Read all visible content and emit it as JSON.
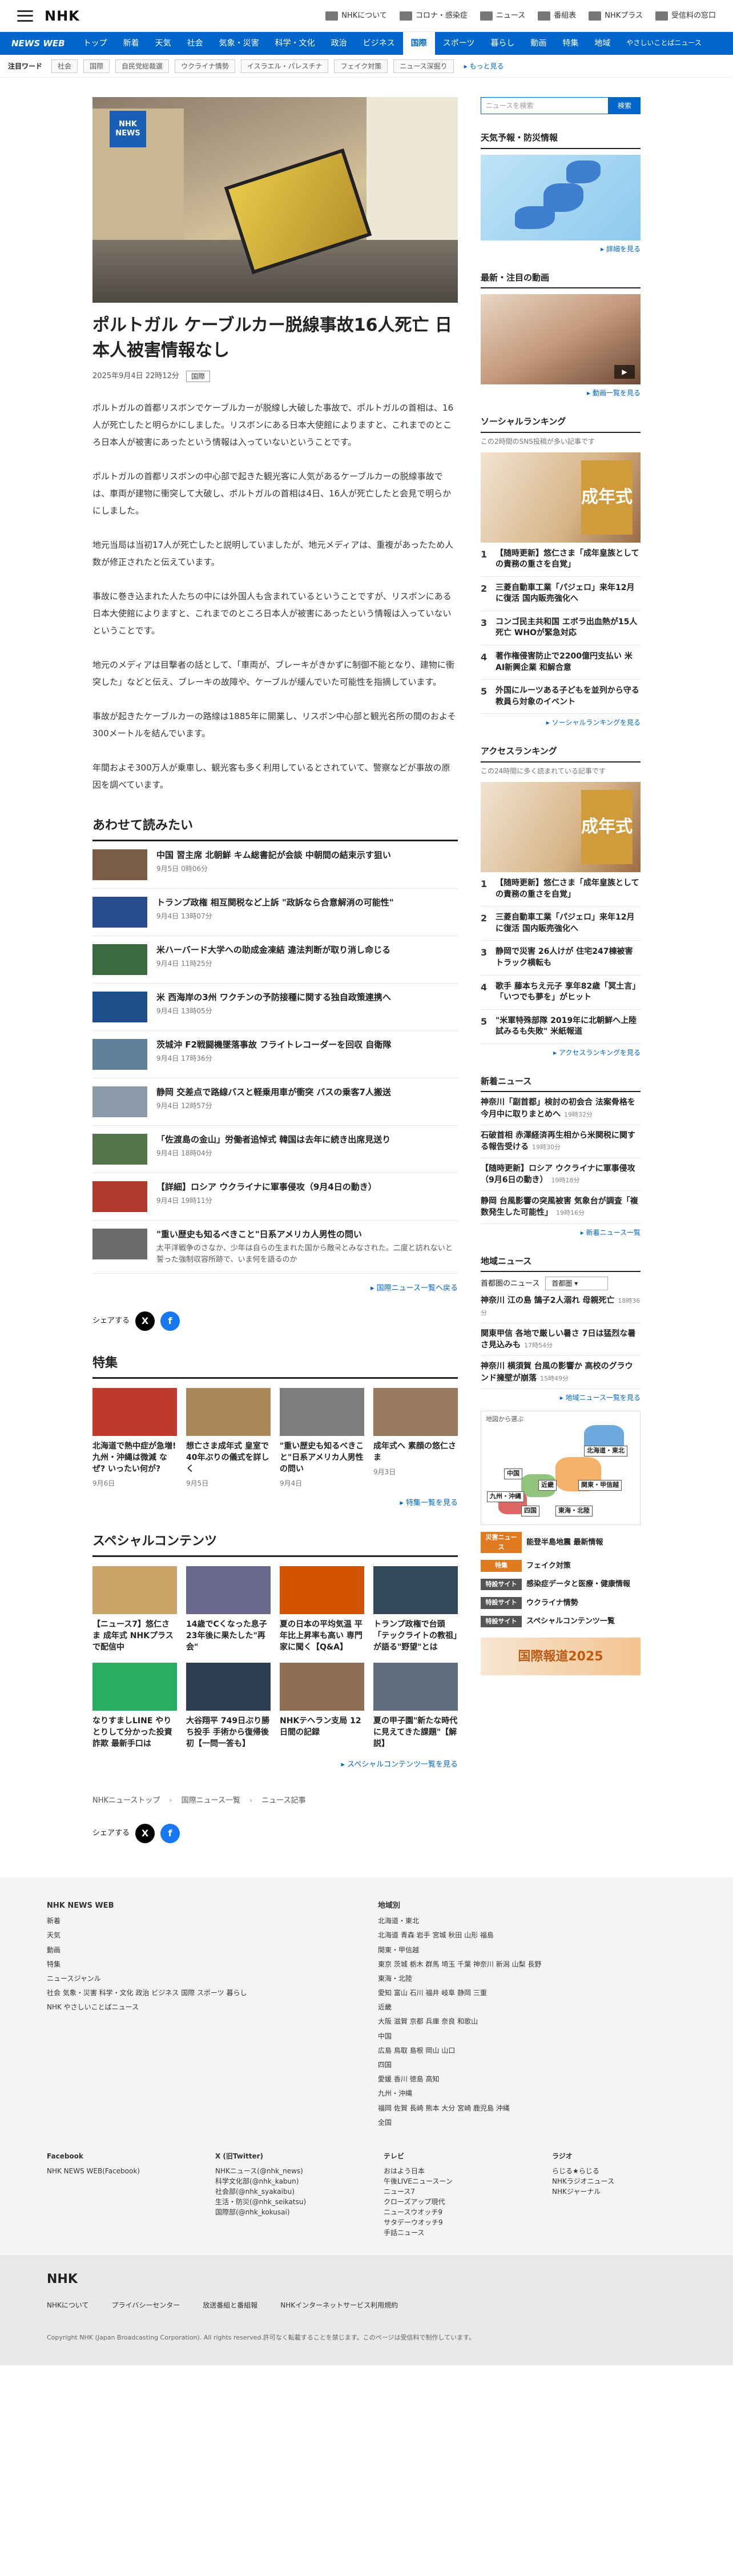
{
  "header": {
    "logo": "NHK",
    "links": [
      {
        "label": "NHKについて",
        "icon": "info-icon"
      },
      {
        "label": "コロナ・感染症",
        "icon": "virus-icon"
      },
      {
        "label": "ニュース",
        "icon": "news-icon"
      },
      {
        "label": "番組表",
        "icon": "tv-guide-icon"
      },
      {
        "label": "NHKプラス",
        "icon": "play-icon"
      },
      {
        "label": "受信料の窓口",
        "icon": "receipt-icon"
      }
    ]
  },
  "nav": {
    "brand": "NEWS WEB",
    "items": [
      "トップ",
      "新着",
      "天気",
      "社会",
      "気象・災害",
      "科学・文化",
      "政治",
      "ビジネス",
      "国際",
      "スポーツ",
      "暮らし",
      "動画",
      "特集",
      "地域",
      "やさしいことばニュース"
    ],
    "active_index": 8
  },
  "keywords": {
    "title": "注目ワード",
    "items": [
      "社会",
      "国際",
      "自民党総裁選",
      "ウクライナ情勢",
      "イスラエル・パレスチナ",
      "フェイク対策",
      "ニュース深掘り"
    ],
    "more": "もっと見る"
  },
  "article": {
    "badge_line1": "NHK",
    "badge_line2": "NEWS",
    "title": "ポルトガル ケーブルカー脱線事故16人死亡 日本人被害情報なし",
    "datetime": "2025年9月4日 22時12分",
    "tag": "国際",
    "paragraphs": [
      "ポルトガルの首都リスボンでケーブルカーが脱線し大破した事故で、ポルトガルの首相は、16人が死亡したと明らかにしました。リスボンにある日本大使館によりますと、これまでのところ日本人が被害にあったという情報は入っていないということです。",
      "ポルトガルの首都リスボンの中心部で起きた観光客に人気があるケーブルカーの脱線事故では、車両が建物に衝突して大破し、ポルトガルの首相は4日、16人が死亡したと会見で明らかにしました。",
      "地元当局は当初17人が死亡したと説明していましたが、地元メディアは、重複があったため人数が修正されたと伝えています。",
      "事故に巻き込まれた人たちの中には外国人も含まれているということですが、リスボンにある日本大使館によりますと、これまでのところ日本人が被害にあったという情報は入っていないということです。",
      "地元のメディアは目撃者の話として、「車両が、ブレーキがきかずに制御不能となり、建物に衝突した」などと伝え、ブレーキの故障や、ケーブルが緩んでいた可能性を指摘しています。",
      "事故が起きたケーブルカーの路線は1885年に開業し、リスボン中心部と観光名所の間のおよそ300メートルを結んでいます。",
      "年間およそ300万人が乗車し、観光客も多く利用しているとされていて、警察などが事故の原因を調べています。"
    ]
  },
  "related": {
    "heading": "あわせて読みたい",
    "items": [
      {
        "title": "中国 習主席 北朝鮮 キム総書記が会談 中朝間の結束示す狙い",
        "date": "9月5日 0時06分",
        "color": "#7a5c48"
      },
      {
        "title": "トランプ政権 相互関税など上訴 \"政訴なら合意解消の可能性\"",
        "date": "9月4日 13時07分",
        "color": "#2a4d8f"
      },
      {
        "title": "米ハーバード大学への助成金凍結 違法判断が取り消し命じる",
        "date": "9月4日 11時25分",
        "color": "#3b6a40"
      },
      {
        "title": "米 西海岸の3州 ワクチンの予防接種に関する独自政策連携へ",
        "date": "9月4日 13時05分",
        "color": "#1e4f8a"
      },
      {
        "title": "茨城沖 F2戦闘機墜落事故 フライトレコーダーを回収 自衛隊",
        "date": "9月4日 17時36分",
        "color": "#5f7f9a"
      },
      {
        "title": "静岡 交差点で路線バスと軽乗用車が衝突 バスの乗客7人搬送",
        "date": "9月4日 12時57分",
        "color": "#8a9aa8"
      },
      {
        "title": "「佐渡島の金山」労働者追悼式 韓国は去年に続き出席見送り",
        "date": "9月4日 18時04分",
        "color": "#55734a"
      },
      {
        "title": "【詳細】ロシア ウクライナに軍事侵攻（9月4日の動き）",
        "date": "9月4日 19時11分",
        "color": "#b03a2e"
      },
      {
        "title": "\"重い歴史も知るべきこと\"日系アメリカ人男性の問い",
        "date": "",
        "desc": "太平洋戦争のさなか、少年は自らの生まれた国から敵국とみなされた。二度と訪れないと誓った強制収容所跡で、いま何を語るのか",
        "color": "#6b6b6b"
      }
    ],
    "more": "国際ニュース一覧へ戻る"
  },
  "share": {
    "label": "シェアする"
  },
  "feature": {
    "heading": "特集",
    "items": [
      {
        "title": "北海道で熱中症が急増! 九州・沖縄は微減 なぜ? いったい何が?",
        "date": "9月6日",
        "color": "#c0392b"
      },
      {
        "title": "想亡さま成年式 皇室で40年ぶりの儀式を詳しく",
        "date": "9月5日",
        "color": "#a9885a"
      },
      {
        "title": "\"重い歴史も知るべきこと\"日系アメリカ人男性の問い",
        "date": "9月4日",
        "color": "#7d7d7d"
      },
      {
        "title": "成年式へ 素顔の悠仁さま",
        "date": "9月3日",
        "color": "#9a7b62"
      }
    ],
    "more": "特集一覧を見る"
  },
  "special": {
    "heading": "スペシャルコンテンツ",
    "items": [
      {
        "title": "【ニュース7】悠仁さま 成年式 NHKプラスで配信中",
        "color": "#c9a56a"
      },
      {
        "title": "14歳でCくなった息子 23年後に果たした\"再会\"",
        "color": "#6a6a8f"
      },
      {
        "title": "夏の日本の平均気温 平年比上昇率も高い 専門家に聞く【Q&A】",
        "color": "#d35400"
      },
      {
        "title": "トランプ政権で台頭「テックライトの教祖」が語る\"野望\"とは",
        "color": "#34495e"
      },
      {
        "title": "なりすましLINE やりとりして分かった投資詐欺 最新手口は",
        "color": "#27ae60"
      },
      {
        "title": "大谷翔平 749日ぶり勝ち投手 手術から復帰後初【一問一答も】",
        "color": "#2c3e50"
      },
      {
        "title": "NHKテヘラン支局 12日間の記録",
        "color": "#8e6e53"
      },
      {
        "title": "夏の甲子園\"新たな時代に見えてきた課題\"【解説】",
        "color": "#5d6d7e"
      }
    ],
    "more": "スペシャルコンテンツ一覧を見る"
  },
  "breadcrumb": [
    "NHKニューストップ",
    "国際ニュース一覧",
    "ニュース記事"
  ],
  "sidebar": {
    "search_placeholder": "ニュースを検索",
    "search_button": "検索",
    "weather_heading": "天気予報・防災情報",
    "weather_more": "詳細を見る",
    "video_heading": "最新・注目の動画",
    "video_more": "動画一覧を見る",
    "social_heading": "ソーシャルランキング",
    "social_note": "この2時間のSNS投稿が多い記事です",
    "social_kanji": "成年式",
    "social_items": [
      "【随時更新】悠仁さま「成年皇族としての責務の重さを自覚」",
      "三菱自動車工業「パジェロ」来年12月に復活 国内販売強化へ",
      "コンゴ民主共和国 エボラ出血熱が15人死亡 WHOが緊急対応",
      "著作権侵害防止で2200億円支払い 米 AI新興企業 和解合意",
      "外国にルーツある子どもを並列から守る 教員ら対象のイベント"
    ],
    "social_more": "ソーシャルランキングを見る",
    "access_heading": "アクセスランキング",
    "access_note": "この24時間に多く読まれている記事です",
    "access_items": [
      "【随時更新】悠仁さま「成年皇族としての責務の重さを自覚」",
      "三菱自動車工業「パジェロ」来年12月に復活 国内販売強化へ",
      "静岡で災害 26人けが 住宅247棟被害 トラック横転も",
      "歌手 藤本ちえ元子 享年82歳「冥土言」「いつでも夢を」がヒット",
      "\"米軍特殊部隊 2019年に北朝鮮へ上陸試みるも失敗\" 米紙報道"
    ],
    "access_more": "アクセスランキングを見る",
    "new_heading": "新着ニュース",
    "new_items": [
      {
        "t": "神奈川「副首都」検討の初会合 法案骨格を今月中に取りまとめへ",
        "tm": "19時32分"
      },
      {
        "t": "石破首相 赤澤経済再生相から米関税に関する報告受ける",
        "tm": "19時30分"
      },
      {
        "t": "【随時更新】ロシア ウクライナに軍事侵攻（9月6日の動き）",
        "tm": "19時18分"
      },
      {
        "t": "静岡 台風影響の突風被害 気象台が調査「複数発生した可能性」",
        "tm": "19時16分"
      }
    ],
    "new_more": "新着ニュース一覧",
    "region_heading": "地域ニュース",
    "region_label": "首都圏のニュース",
    "region_select": "首都圏",
    "region_items": [
      {
        "t": "神奈川 江の島 鵠子2人溺れ 母親死亡",
        "tm": "18時36分"
      },
      {
        "t": "関東甲信 各地で厳しい暑さ 7日は猛烈な暑さ見込みも",
        "tm": "17時54分"
      },
      {
        "t": "神奈川 横須賀 台風の影響か 高校のグラウンド擁壁が崩落",
        "tm": "15時49分"
      }
    ],
    "region_more": "地域ニュース一覧を見る",
    "map_title": "地図から選ぶ",
    "map_regions": [
      "北海道・東北",
      "中国",
      "近畿",
      "関東・甲信越",
      "九州・沖縄",
      "四国",
      "東海・北陸"
    ],
    "banners": [
      {
        "label": "災害ニュース",
        "text": "能登半島地震 最新情報"
      },
      {
        "label": "特集",
        "text": "フェイク対策"
      },
      {
        "label": "特設サイト",
        "text": "感染症データと医療・健康情報"
      },
      {
        "label": "特設サイト",
        "text": "ウクライナ情勢"
      },
      {
        "label": "特設サイト",
        "text": "スペシャルコンテンツ一覧"
      }
    ],
    "ad": "国際報道2025"
  },
  "footer": {
    "col1_heading": "NHK NEWS WEB",
    "col1_links": [
      "新着",
      "天気",
      "動画",
      "特集",
      "ニュースジャンル",
      "社会 気象・災害 科学・文化 政治 ビジネス 国際 スポーツ 暮らし",
      "NHK やさしいことばニュース"
    ],
    "col2_heading": "地域別",
    "col2_links": [
      "北海道・東北",
      "北海道 青森 岩手 宮城 秋田 山形 福島",
      "関東・甲信越",
      "東京 茨城 栃木 群馬 埼玉 千葉 神奈川 新潟 山梨 長野",
      "東海・北陸",
      "愛知 富山 石川 福井 岐阜 静岡 三重",
      "近畿",
      "大阪 滋賀 京都 兵庫 奈良 和歌山",
      "中国",
      "広島 鳥取 島根 岡山 山口",
      "四国",
      "愛媛 香川 徳島 高知",
      "九州・沖縄",
      "福岡 佐賀 長崎 熊本 大分 宮崎 鹿児島 沖縄",
      "全国"
    ],
    "social_cols": [
      {
        "h": "Facebook",
        "items": [
          "NHK NEWS WEB(Facebook)"
        ]
      },
      {
        "h": "X (旧Twitter)",
        "items": [
          "NHKニュース(@nhk_news)",
          "科学文化部(@nhk_kabun)",
          "社会部(@nhk_syakaibu)",
          "生活・防災(@nhk_seikatsu)",
          "国際部(@nhk_kokusai)"
        ]
      },
      {
        "h": "テレビ",
        "items": [
          "おはよう日本",
          "午後LIVEニュースーン",
          "ニュース7",
          "クローズアップ現代",
          "ニュースウオッチ9",
          "サタデーウオッチ9",
          "手話ニュース"
        ]
      },
      {
        "h": "ラジオ",
        "items": [
          "らじる★らじる",
          "NHKラジオニュース",
          "NHKジャーナル"
        ]
      }
    ],
    "logo": "NHK",
    "bottom_links": [
      "NHKについて",
      "プライバシーセンター",
      "放送番組と番組報",
      "NHKインターネットサービス利用規約"
    ],
    "copyright": "Copyright NHK (Japan Broadcasting Corporation). All rights reserved.許可なく転載することを禁じます。このページは受信料で制作しています。"
  }
}
